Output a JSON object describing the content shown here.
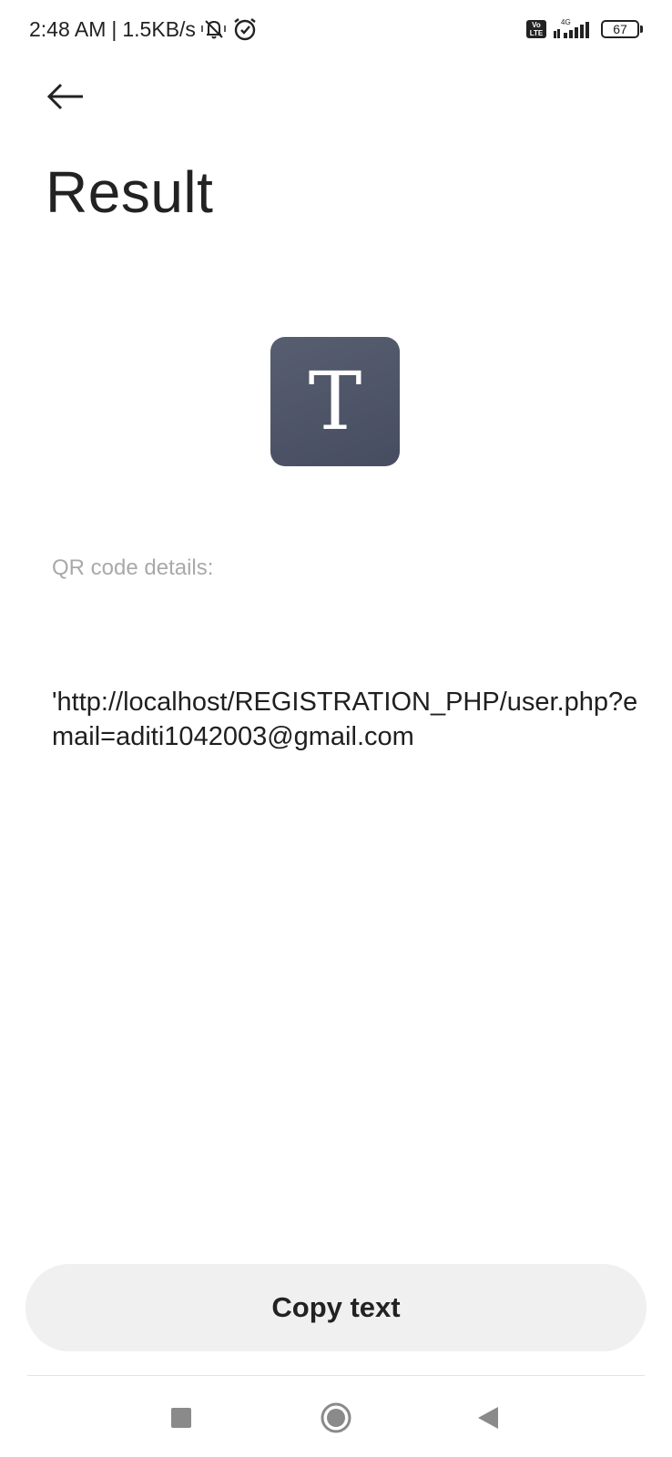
{
  "status_bar": {
    "time": "2:48 AM",
    "separator": "|",
    "network_speed": "1.5KB/s",
    "icons_left": [
      "bell-muted-icon",
      "alarm-clock-icon"
    ],
    "volte_label": "Vo LTE",
    "network_type": "4G",
    "icons_right": [
      "volte-icon",
      "signal-icon",
      "battery-icon"
    ],
    "battery_level": "67"
  },
  "header": {
    "back_icon": "arrow-left-icon",
    "title": "Result"
  },
  "type_icon": {
    "letter": "T",
    "color": "#4f5568"
  },
  "details": {
    "label": "QR code details:",
    "content": "'http://localhost/REGISTRATION_PHP/user.php?email=aditi1042003@gmail.com"
  },
  "actions": {
    "copy_label": "Copy text"
  },
  "nav_bar": {
    "items": [
      "recent-apps-icon",
      "home-icon",
      "back-icon"
    ]
  },
  "colors": {
    "background": "#ffffff",
    "button_background": "#f0f0f0",
    "label_gray": "#a9a9a9",
    "icon_tile": "#4f5568"
  }
}
